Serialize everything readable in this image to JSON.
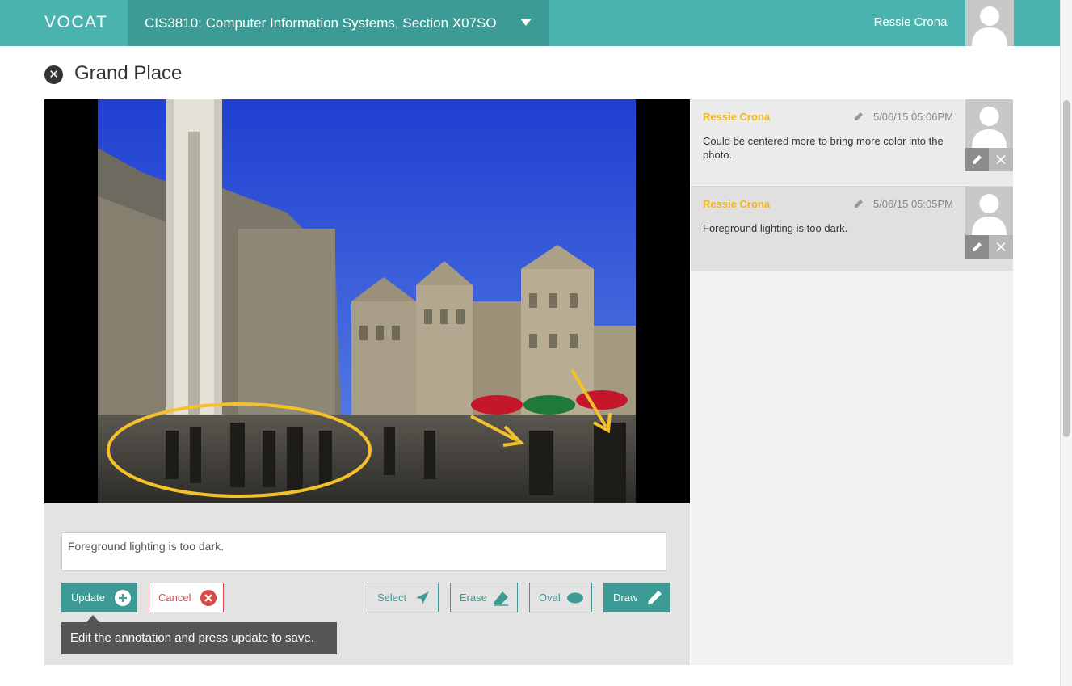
{
  "header": {
    "logo": "VOCAT",
    "course": "CIS3810: Computer Information Systems, Section X07SO",
    "user_name": "Ressie Crona"
  },
  "page": {
    "title": "Grand Place"
  },
  "editor": {
    "annotation_value": "Foreground lighting is too dark.",
    "update_label": "Update",
    "cancel_label": "Cancel",
    "select_label": "Select",
    "erase_label": "Erase",
    "oval_label": "Oval",
    "draw_label": "Draw",
    "tooltip": "Edit the annotation and press update to save."
  },
  "comments": [
    {
      "author": "Ressie Crona",
      "date": "5/06/15 05:06PM",
      "text": "Could be centered more to bring more color into the photo."
    },
    {
      "author": "Ressie Crona",
      "date": "5/06/15 05:05PM",
      "text": "Foreground lighting is too dark."
    }
  ],
  "colors": {
    "brand": "#4bb3ad",
    "brand_dark": "#3d9b95",
    "accent_author": "#f2b71a",
    "cancel": "#d94a4a",
    "annotation_stroke": "#f5c12b"
  }
}
